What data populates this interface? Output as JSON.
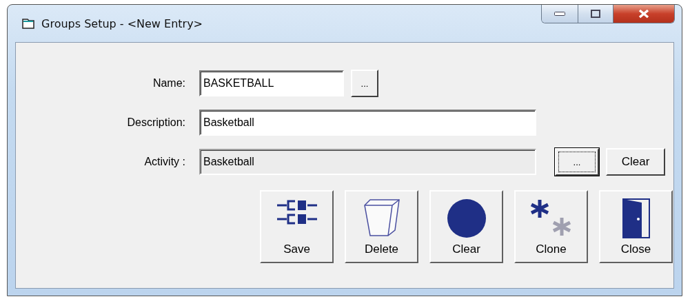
{
  "window": {
    "title": "Groups Setup - <New Entry>"
  },
  "fields": [
    {
      "label": "Name:",
      "value": "BASKETBALL",
      "disabled": false
    },
    {
      "label": "Description:",
      "value": "Basketball",
      "disabled": false
    },
    {
      "label": "Activity :",
      "value": "Basketball",
      "disabled": true
    }
  ],
  "name_browse": {
    "label": "..."
  },
  "activity_browse": {
    "label": "...",
    "focused": true
  },
  "activity_clear": {
    "label": "Clear"
  },
  "actions": [
    {
      "label": "Save",
      "kind": "save"
    },
    {
      "label": "Delete",
      "kind": "delete"
    },
    {
      "label": "Clear",
      "kind": "clear"
    },
    {
      "label": "Clone",
      "kind": "clone"
    },
    {
      "label": "Close",
      "kind": "close"
    }
  ]
}
